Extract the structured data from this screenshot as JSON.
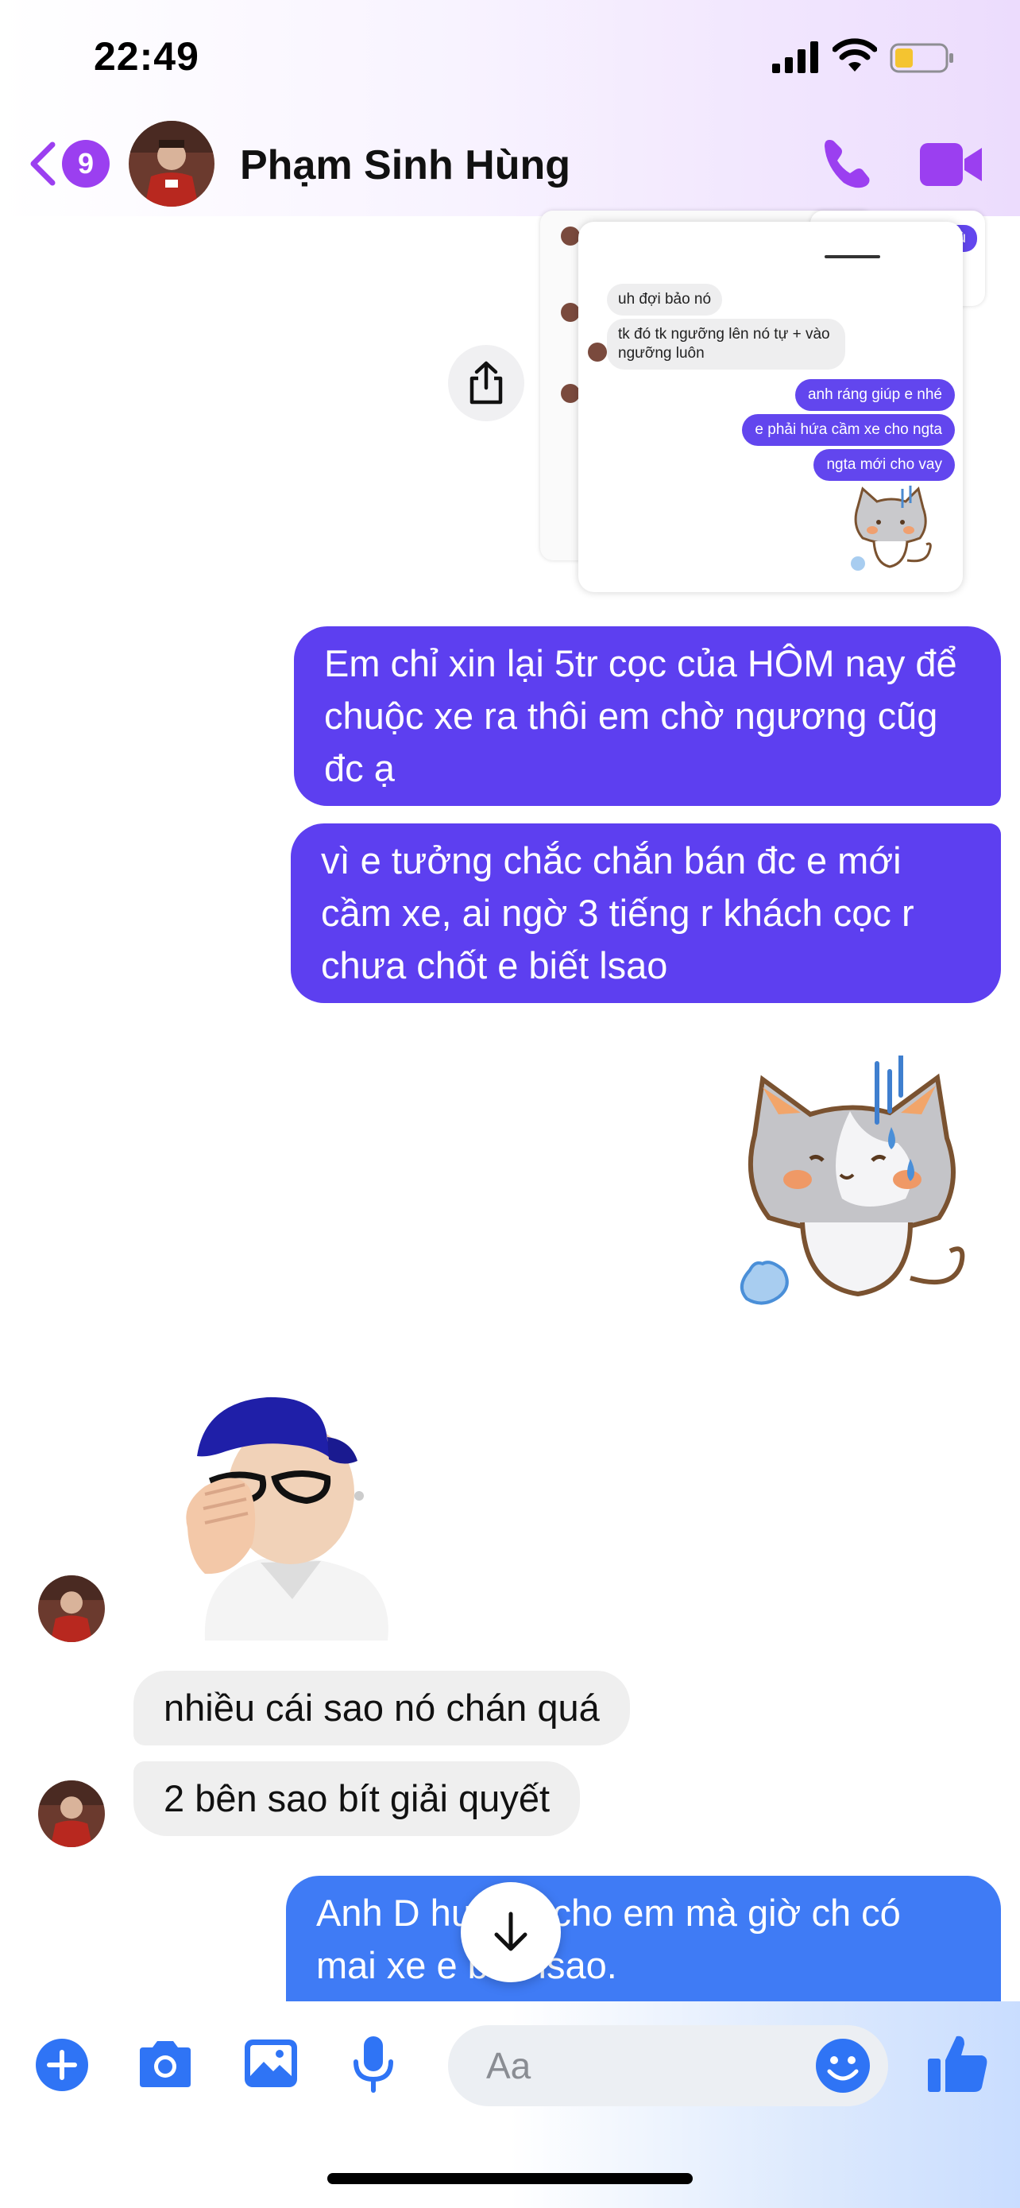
{
  "status_bar": {
    "time": "22:49"
  },
  "header": {
    "back_badge": "9",
    "contact_name": "Phạm Sinh Hùng"
  },
  "shared_screenshot": {
    "incoming": [
      "uh đợi bảo nó",
      "tk đó tk ngưỡng lên nó tự + vào ngưỡng luôn"
    ],
    "outgoing": [
      "anh ráng giúp e nhé",
      "e phải hứa cầm xe cho ngta",
      "ngta mới cho vay"
    ],
    "peek_text": "e bù"
  },
  "messages": [
    {
      "from": "me",
      "text": "Em chỉ xin lại 5tr cọc của HÔM nay để chuộc xe ra thôi em chờ ngương cũg đc ạ"
    },
    {
      "from": "me",
      "text": "vì e tưởng chắc chắn bán đc e mới cầm xe, ai ngờ 3 tiếng r khách cọc r chưa chốt e biết lsao"
    },
    {
      "from": "them",
      "text": "nhiều cái sao nó chán quá"
    },
    {
      "from": "them",
      "text": "2 bên sao bít giải quyết"
    },
    {
      "from": "me",
      "text": "Anh D hướng cho em mà giờ ch có mai xe e biết lsao."
    }
  ],
  "composer": {
    "placeholder": "Aa"
  },
  "colors": {
    "outgoing_bubble": "#5d3ff0",
    "outgoing_bubble_latest": "#3f7bf5",
    "incoming_bubble": "#efefef",
    "accent": "#9b3ff0"
  }
}
